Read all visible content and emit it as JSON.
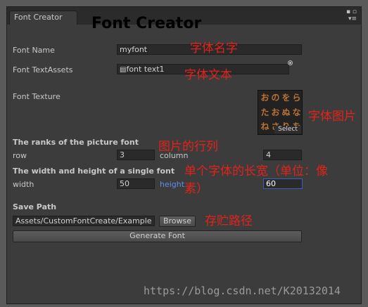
{
  "window": {
    "tab_label": "Font Creator",
    "controls": "▪ ▫\n▾≡"
  },
  "heading": "Font Creator",
  "font_name": {
    "label": "Font Name",
    "value": "myfont",
    "annotation": "字体名字"
  },
  "text_assets": {
    "label": "Font TextAssets",
    "value": "font text1",
    "annotation": "字体文本"
  },
  "texture": {
    "label": "Font Texture",
    "select_label": "Select",
    "annotation": "字体图片",
    "glyphs": [
      "お",
      "の",
      "を",
      "ら",
      "た",
      "お",
      "ぬ",
      "な",
      "ね",
      "さ",
      "り",
      "を"
    ]
  },
  "ranks": {
    "heading": "The ranks of the picture font",
    "row_label": "row",
    "row_value": "3",
    "column_label": "column",
    "column_value": "4",
    "annotation": "图片的行列"
  },
  "size": {
    "heading": "The width and height of a single font",
    "width_label": "width",
    "width_value": "50",
    "height_label": "height",
    "height_value": "60",
    "annotation_line1": "单个字体的长宽（单位：像",
    "annotation_line2": "素）"
  },
  "save": {
    "heading": "Save Path",
    "path_value": "Assets/CustomFontCreate/Example",
    "browse_label": "Browse",
    "annotation": "存贮路径"
  },
  "generate_label": "Generate Font",
  "watermark": "https://blog.csdn.net/K20132014"
}
